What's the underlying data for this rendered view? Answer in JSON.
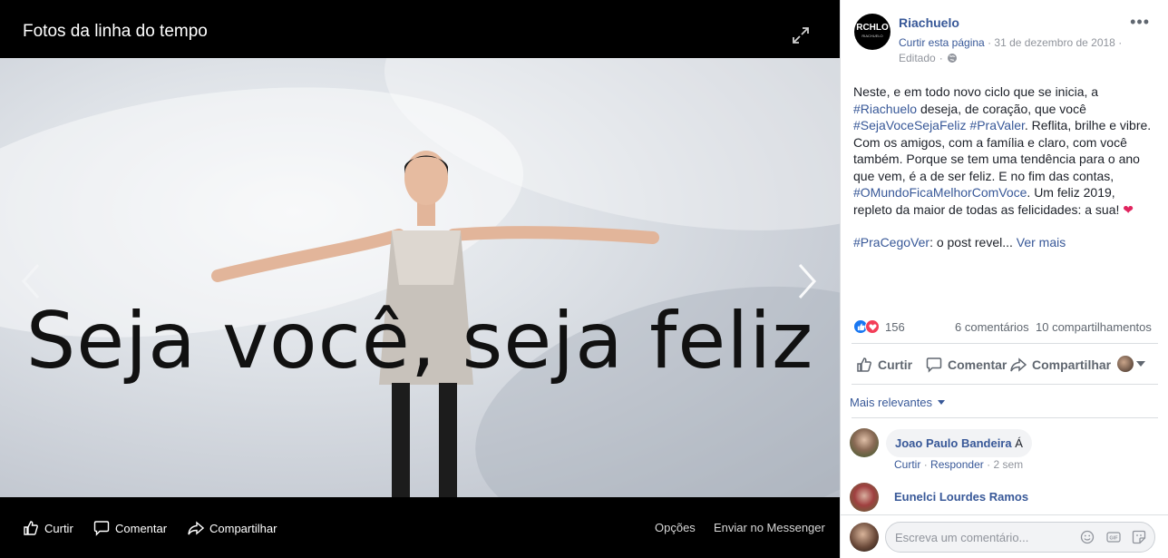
{
  "viewer": {
    "title": "Fotos da linha do tempo",
    "photo_text": "Seja você, seja feliz",
    "actions": {
      "like": "Curtir",
      "comment": "Comentar",
      "share": "Compartilhar",
      "options": "Opções",
      "send_messenger": "Enviar no Messenger"
    }
  },
  "post": {
    "page_avatar_text": "RCHLO",
    "page_avatar_sub": "RIACHUELO",
    "page_name": "Riachuelo",
    "like_page": "Curtir esta página",
    "date": "31 de dezembro de 2018",
    "edited": "Editado",
    "text": {
      "p1_a": "Neste, e em todo novo ciclo que se inicia, a ",
      "tag_riachuelo": "#Riachuelo",
      "p1_b": " deseja, de coração, que você ",
      "tag_seja": "#SejaVoceSejaFeliz",
      "tag_pravaler": "#PraValer",
      "p1_c": ". Reflita, brilhe e vibre. Com os amigos, com a família e claro, com você também. Porque se tem uma tendência para o ano que vem, é a de ser feliz. E no fim das contas, ",
      "tag_mundo": "#OMundoFicaMelhorComVoce",
      "p1_d": ". Um feliz 2019, repleto da maior de todas as felicidades: a sua! ",
      "heart": "❤",
      "tag_pracego": "#PraCegoVer",
      "p2_b": ": o post revel... ",
      "see_more": "Ver mais"
    },
    "reactions_count": "156",
    "comments_count": "6 comentários",
    "shares_count": "10 compartilhamentos",
    "actions": {
      "like": "Curtir",
      "comment": "Comentar",
      "share": "Compartilhar"
    },
    "sort_label": "Mais relevantes"
  },
  "comments": [
    {
      "author": "Joao Paulo Bandeira",
      "text": "Á",
      "like": "Curtir",
      "reply": "Responder",
      "time": "2 sem"
    },
    {
      "author": "Eunelci Lourdes Ramos"
    }
  ],
  "composer": {
    "placeholder": "Escreva um comentário..."
  },
  "colors": {
    "link": "#385898",
    "viewer_bg": "#000000",
    "love": "#f33e58",
    "like": "#1877f2"
  }
}
